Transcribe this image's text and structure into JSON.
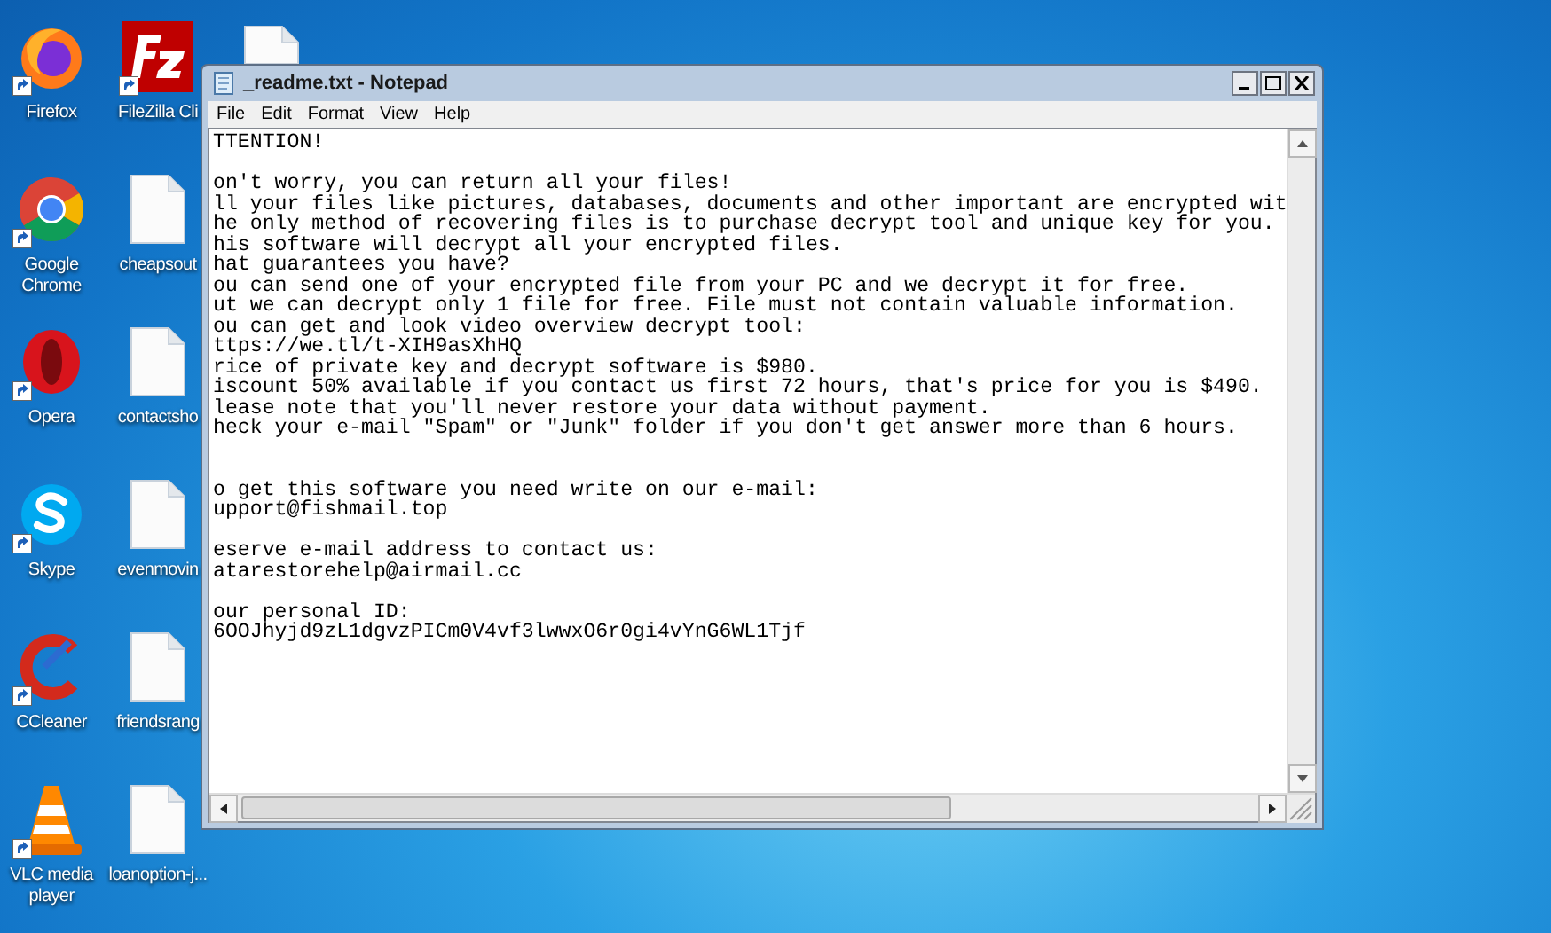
{
  "desktop": {
    "columns": [
      [
        {
          "kind": "firefox",
          "label": "Firefox",
          "shortcut": true
        },
        {
          "kind": "chrome",
          "label": "Google Chrome",
          "shortcut": true
        },
        {
          "kind": "opera",
          "label": "Opera",
          "shortcut": true
        },
        {
          "kind": "skype",
          "label": "Skype",
          "shortcut": true
        },
        {
          "kind": "ccleaner",
          "label": "CCleaner",
          "shortcut": true
        },
        {
          "kind": "vlc",
          "label": "VLC media player",
          "shortcut": true
        }
      ],
      [
        {
          "kind": "filezilla",
          "label": "FileZilla Cli",
          "shortcut": true
        },
        {
          "kind": "document",
          "label": "cheapsout",
          "shortcut": false
        },
        {
          "kind": "document",
          "label": "contactsho",
          "shortcut": false
        },
        {
          "kind": "document",
          "label": "evenmovin",
          "shortcut": false
        },
        {
          "kind": "document",
          "label": "friendsrang",
          "shortcut": false
        },
        {
          "kind": "document",
          "label": "loanoption-j...",
          "shortcut": false
        }
      ],
      [
        {
          "kind": "document_top",
          "shortcut": false
        }
      ]
    ]
  },
  "notepad": {
    "title": "_readme.txt - Notepad",
    "menu": [
      "File",
      "Edit",
      "Format",
      "View",
      "Help"
    ],
    "blocks": [
      {
        "kind": "text",
        "lines": [
          "TTENTION!"
        ]
      },
      {
        "kind": "blank"
      },
      {
        "kind": "text",
        "lines": [
          "on't worry, you can return all your files!",
          "ll your files like pictures, databases, documents and other important are encrypted wit",
          "he only method of recovering files is to purchase decrypt tool and unique key for you.",
          "his software will decrypt all your encrypted files.",
          "hat guarantees you have?",
          "ou can send one of your encrypted file from your PC and we decrypt it for free.",
          "ut we can decrypt only 1 file for free. File must not contain valuable information.",
          "ou can get and look video overview decrypt tool:",
          "ttps://we.tl/t-XIH9asXhHQ",
          "rice of private key and decrypt software is $980.",
          "iscount 50% available if you contact us first 72 hours, that's price for you is $490.",
          "lease note that you'll never restore your data without payment.",
          "heck your e-mail \"Spam\" or \"Junk\" folder if you don't get answer more than 6 hours."
        ]
      },
      {
        "kind": "blank"
      },
      {
        "kind": "blank"
      },
      {
        "kind": "text",
        "lines": [
          "o get this software you need write on our e-mail:",
          "upport@fishmail.top"
        ]
      },
      {
        "kind": "blank"
      },
      {
        "kind": "text",
        "lines": [
          "eserve e-mail address to contact us:",
          "atarestorehelp@airmail.cc"
        ]
      },
      {
        "kind": "blank"
      },
      {
        "kind": "text",
        "lines": [
          "our personal ID:",
          "6OOJhyjd9zL1dgvzPICm0V4vf3lwwxO6r0gi4vYnG6WL1Tjf"
        ]
      }
    ]
  }
}
